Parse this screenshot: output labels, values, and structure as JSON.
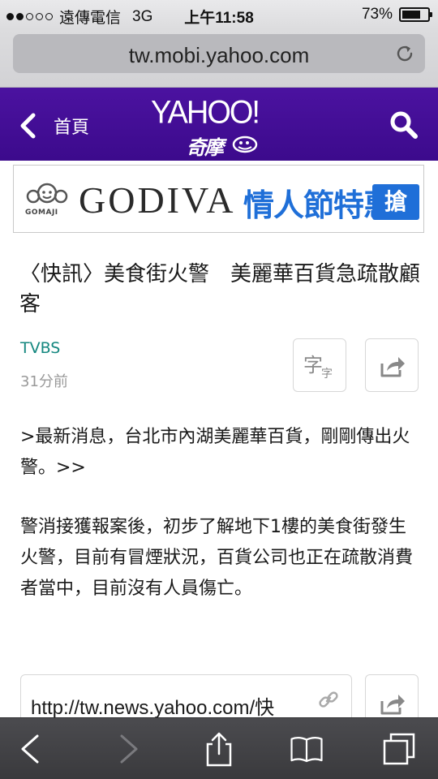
{
  "status_bar": {
    "carrier": "遠傳電信",
    "network": "3G",
    "time": "上午11:58",
    "battery_percent": "73%",
    "battery_level": 0.73,
    "signal_bars": 2
  },
  "browser": {
    "url": "tw.mobi.yahoo.com"
  },
  "header": {
    "back_label": "首頁",
    "logo_text": "YAHOO!",
    "logo_sub": "奇摩"
  },
  "ad": {
    "sponsor": "GOMAJI",
    "brand": "GODIVA",
    "promo": "情人節特惠！",
    "cta": "搶"
  },
  "article": {
    "headline": "〈快訊〉美食街火警　美麗華百貨急疏散顧客",
    "source": "TVBS",
    "time_ago": "31分前",
    "font_button_big": "字",
    "font_button_small": "字",
    "paragraphs": [
      ">最新消息，台北市內湖美麗華百貨，剛剛傳出火警。>>",
      "警消接獲報案後，初步了解地下1樓的美食街發生火警，目前有冒煙狀況，百貨公司也正在疏散消費者當中，目前沒有人員傷亡。"
    ],
    "link": "http://tw.news.yahoo.com/快"
  },
  "colors": {
    "yahoo_purple": "#400090",
    "source_teal": "#14877f",
    "ad_blue": "#1f6fd8",
    "toolbar": "#3a3a3d"
  },
  "icons": [
    "reload-icon",
    "back-chevron-icon",
    "search-icon",
    "share-icon",
    "link-icon",
    "toolbar-back-icon",
    "toolbar-forward-icon",
    "toolbar-share-icon",
    "bookmarks-icon",
    "tabs-icon"
  ]
}
